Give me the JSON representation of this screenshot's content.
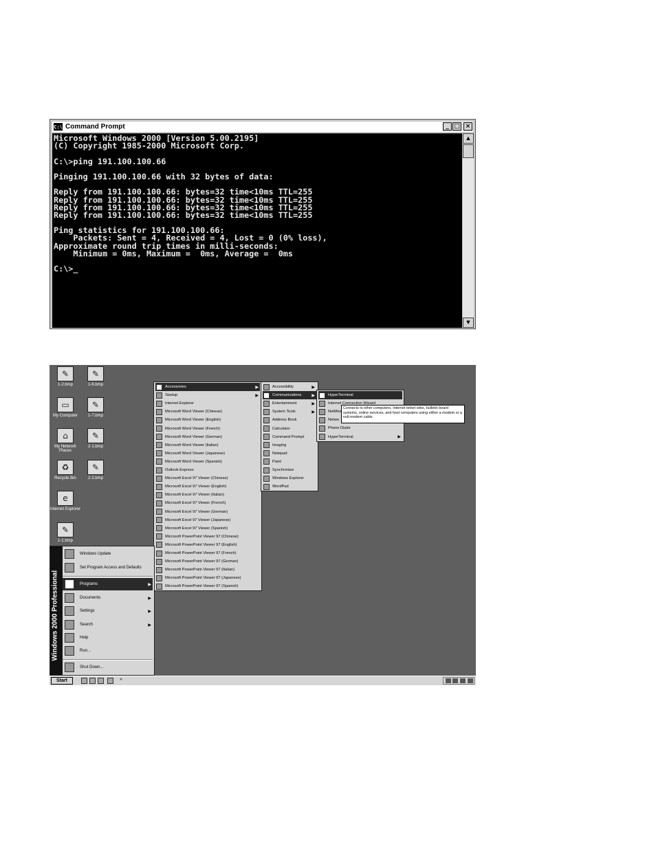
{
  "cmd_window": {
    "title": "Command Prompt",
    "icon_label": "C:\\",
    "buttons": [
      "_",
      "□",
      "×"
    ],
    "console_lines": [
      "Microsoft Windows 2000 [Version 5.00.2195]",
      "(C) Copyright 1985-2000 Microsoft Corp.",
      "",
      "C:\\>ping 191.100.100.66",
      "",
      "Pinging 191.100.100.66 with 32 bytes of data:",
      "",
      "Reply from 191.100.100.66: bytes=32 time<10ms TTL=255",
      "Reply from 191.100.100.66: bytes=32 time<10ms TTL=255",
      "Reply from 191.100.100.66: bytes=32 time<10ms TTL=255",
      "Reply from 191.100.100.66: bytes=32 time<10ms TTL=255",
      "",
      "Ping statistics for 191.100.100.66:",
      "    Packets: Sent = 4, Received = 4, Lost = 0 (0% loss),",
      "Approximate round trip times in milli-seconds:",
      "    Minimum = 0ms, Maximum =  0ms, Average =  0ms",
      "",
      "C:\\>_"
    ]
  },
  "desktop": {
    "icons": [
      "1-2.bmp",
      "1-6.bmp",
      "My Computer",
      "1-7.bmp",
      "My Network Places",
      "2-1.bmp",
      "Recycle Bin",
      "2-2.bmp",
      "Internet Explorer",
      "1-1.bmp"
    ],
    "programs_menu": [
      "Accessories",
      "Startup",
      "Internet Explorer",
      "Microsoft Word Viewer (Chinese)",
      "Microsoft Word Viewer (English)",
      "Microsoft Word Viewer (French)",
      "Microsoft Word Viewer (German)",
      "Microsoft Word Viewer (Italian)",
      "Microsoft Word Viewer (Japanese)",
      "Microsoft Word Viewer (Spanish)",
      "Outlook Express",
      "Microsoft Excel 97 Viewer (Chinese)",
      "Microsoft Excel 97 Viewer (English)",
      "Microsoft Excel 97 Viewer (Italian)",
      "Microsoft Excel 97 Viewer (French)",
      "Microsoft Excel 97 Viewer (German)",
      "Microsoft Excel 97 Viewer (Japanese)",
      "Microsoft Excel 97 Viewer (Spanish)",
      "Microsoft PowerPoint Viewer 97 (Chinese)",
      "Microsoft PowerPoint Viewer 97 (English)",
      "Microsoft PowerPoint Viewer 97 (French)",
      "Microsoft PowerPoint Viewer 97 (German)",
      "Microsoft PowerPoint Viewer 97 (Italian)",
      "Microsoft PowerPoint Viewer 97 (Japanese)",
      "Microsoft PowerPoint Viewer 97 (Spanish)"
    ],
    "accessories_menu": [
      "Accessibility",
      "Communications",
      "Entertainment",
      "System Tools",
      "Address Book",
      "Calculator",
      "Command Prompt",
      "Imaging",
      "Notepad",
      "Paint",
      "Synchronize",
      "Windows Explorer",
      "WordPad"
    ],
    "communications_menu": [
      "HyperTerminal",
      "Internet Connection Wizard",
      "NetMeeting",
      "Network and Dial-up Connections",
      "Phone Dialer",
      "HyperTerminal"
    ],
    "communications_menu_visible": [
      "HyperTerminal",
      "Internet Connection Wizard",
      "NetMee",
      "Netwo",
      "Phone Dialer",
      "HyperTerminal"
    ],
    "tooltip": "Connects to other computers, Internet telnet sites, bulletin board systems, online services, and host computers using either a modem or a null-modem cable.",
    "start_menu": {
      "banner": "Windows 2000 Professional",
      "top_items": [
        "Windows Update",
        "Set Program Access and Defaults"
      ],
      "items": [
        "Programs",
        "Documents",
        "Settings",
        "Search",
        "Help",
        "Run...",
        "Shut Down..."
      ]
    },
    "taskbar": {
      "start_label": "Start",
      "more": "»"
    }
  }
}
